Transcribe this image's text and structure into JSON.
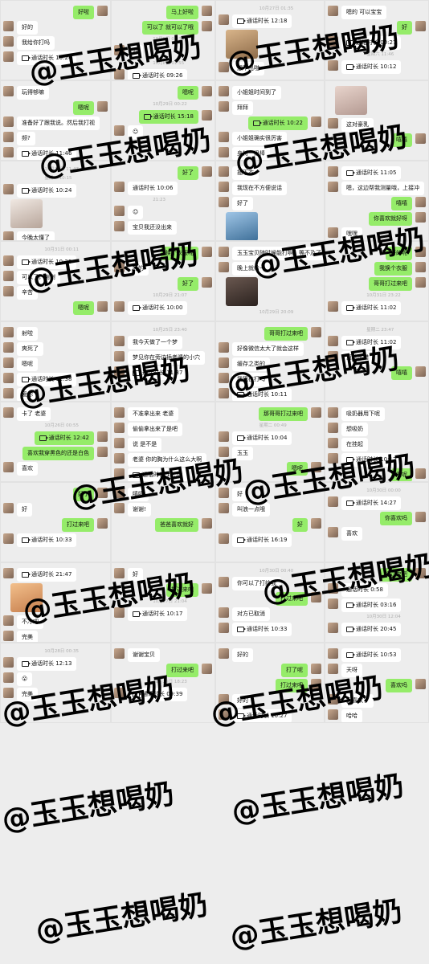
{
  "watermark_text": "@玉玉想喝奶",
  "panels": [
    {
      "messages": [
        {
          "type": "out",
          "text": "好啦"
        },
        {
          "type": "in",
          "text": "好的"
        },
        {
          "type": "in",
          "text": "我给你打吗"
        },
        {
          "type": "in",
          "call": true,
          "text": "通话时长 10:24"
        }
      ]
    },
    {
      "messages": [
        {
          "type": "out",
          "text": "马上好啦"
        },
        {
          "type": "out",
          "text": "可以了 就可以了哦"
        },
        {
          "type": "ts",
          "text": "10月8日 01:34"
        },
        {
          "type": "in",
          "text": "好"
        },
        {
          "type": "ts",
          "text": "10月8日 01:55"
        },
        {
          "type": "in",
          "call": true,
          "text": "通话时长 09:26"
        },
        {
          "type": "in",
          "text": "早点休息哈！"
        }
      ]
    },
    {
      "messages": [
        {
          "type": "ts",
          "text": "10月27日 01:35"
        },
        {
          "type": "in",
          "call": true,
          "text": "通话时长 12:18"
        },
        {
          "type": "photo",
          "name": "dog-photo"
        },
        {
          "type": "in",
          "text": "想不出啦"
        }
      ]
    },
    {
      "messages": [
        {
          "type": "in",
          "text": "嗯的 可以宝宝"
        },
        {
          "type": "out",
          "text": "好"
        },
        {
          "type": "in",
          "call": true,
          "text": "通话时长 00:27"
        },
        {
          "type": "ts",
          "text": "星期六 11:46"
        },
        {
          "type": "in",
          "call": true,
          "text": "通话时长 10:12"
        },
        {
          "type": "in",
          "call": true,
          "text": "通话时长 08:24"
        }
      ]
    },
    {
      "messages": [
        {
          "type": "in",
          "text": "玩得够嘛"
        },
        {
          "type": "out",
          "text": "嗯呢"
        },
        {
          "type": "in",
          "text": "准备好了跟我说。然后我打视"
        },
        {
          "type": "in",
          "text": "频?"
        },
        {
          "type": "in",
          "call": true,
          "text": "通话时长 11:46"
        },
        {
          "type": "ts",
          "text": "10月31日 11:50"
        }
      ]
    },
    {
      "messages": [
        {
          "type": "out",
          "text": "嗯呢"
        },
        {
          "type": "ts",
          "text": "10月29日 00:22"
        },
        {
          "type": "out",
          "call": true,
          "text": "通话时长 15:18"
        },
        {
          "type": "in",
          "text": "☺"
        }
      ]
    },
    {
      "messages": [
        {
          "type": "in",
          "text": "小姐姐时间到了"
        },
        {
          "type": "in",
          "text": "拜拜"
        },
        {
          "type": "out",
          "call": true,
          "text": "通话时长 10:22"
        },
        {
          "type": "in",
          "text": "小姐姐确实很厉害"
        },
        {
          "type": "in",
          "text": "身材一级棒"
        },
        {
          "type": "out",
          "text": "嘻嘻"
        }
      ]
    },
    {
      "messages": [
        {
          "type": "photo",
          "name": "portrait-photo"
        },
        {
          "type": "in",
          "text": "这对豪乳"
        },
        {
          "type": "out",
          "text": "嘻嘻"
        }
      ]
    },
    {
      "messages": [
        {
          "type": "ts",
          "text": "10月31日 11:47"
        },
        {
          "type": "ts",
          "text": "星期一 10:15"
        },
        {
          "type": "in",
          "call": true,
          "text": "通话时长 10:24"
        },
        {
          "type": "photo",
          "name": "cat-sticker"
        },
        {
          "type": "in",
          "text": "今晚太懂了"
        }
      ]
    },
    {
      "messages": [
        {
          "type": "out",
          "text": "好了"
        },
        {
          "type": "in",
          "text": "通话时长 10:06"
        },
        {
          "type": "ts",
          "text": "21:23"
        },
        {
          "type": "in",
          "text": "☺"
        },
        {
          "type": "in",
          "text": "宝贝我还没出来"
        }
      ]
    },
    {
      "messages": [
        {
          "type": "in",
          "text": "插下衣"
        },
        {
          "type": "in",
          "text": "我现在不方便说话"
        },
        {
          "type": "in",
          "text": "好了"
        },
        {
          "type": "photo",
          "name": "thumb-sticker"
        },
        {
          "type": "in",
          "text": "朋克的青龙"
        },
        {
          "type": "out",
          "call": true,
          "text": "通话时长 09:57"
        }
      ]
    },
    {
      "messages": [
        {
          "type": "in",
          "call": true,
          "text": "通话时长 11:05"
        },
        {
          "type": "in",
          "text": "嗯，这边帮我测量哦，上接冲"
        },
        {
          "type": "out",
          "text": "嘻嘻"
        },
        {
          "type": "out",
          "text": "你喜欢就好呀"
        },
        {
          "type": "in",
          "text": "嘿嘿"
        }
      ]
    },
    {
      "messages": [
        {
          "type": "ts",
          "text": "10月31日 00:11"
        },
        {
          "type": "in",
          "call": true,
          "text": "通话时长 10:25"
        },
        {
          "type": "in",
          "text": "可以了，谢谢"
        },
        {
          "type": "in",
          "text": "辛苦"
        },
        {
          "type": "out",
          "text": "嗯呢"
        }
      ]
    },
    {
      "messages": [
        {
          "type": "out",
          "text": "换个衣服呢"
        },
        {
          "type": "in",
          "text": "好的"
        },
        {
          "type": "out",
          "text": "好了"
        },
        {
          "type": "ts",
          "text": "10月29日 21:07"
        },
        {
          "type": "in",
          "call": true,
          "text": "通话时长 10:00"
        },
        {
          "type": "in",
          "text": "辛苦"
        }
      ]
    },
    {
      "messages": [
        {
          "type": "in",
          "text": "玉玉宝贝随时候能打啊，等不及了"
        },
        {
          "type": "in",
          "text": "晚上就给~"
        },
        {
          "type": "photo",
          "name": "shadow-photo"
        },
        {
          "type": "ts",
          "text": "10月29日 20:09"
        },
        {
          "type": "in",
          "text": "好大的奶😍😍😍"
        },
        {
          "type": "out",
          "text": "手机最近消息提示总是延迟"
        }
      ]
    },
    {
      "messages": [
        {
          "type": "out",
          "text": "好的呢"
        },
        {
          "type": "out",
          "text": "我换个衣服"
        },
        {
          "type": "out",
          "text": "哥哥打过来吧"
        },
        {
          "type": "ts",
          "text": "10月31日 23:22"
        },
        {
          "type": "in",
          "call": true,
          "text": "通话时长 11:02"
        }
      ]
    },
    {
      "messages": [
        {
          "type": "in",
          "text": "射啦"
        },
        {
          "type": "in",
          "text": "爽死了"
        },
        {
          "type": "in",
          "text": "嗯呢"
        },
        {
          "type": "in",
          "call": true,
          "text": "通话时长 11:38"
        },
        {
          "type": "in",
          "text": "爱你"
        },
        {
          "type": "out",
          "text": "嘻嘻"
        }
      ]
    },
    {
      "messages": [
        {
          "type": "ts",
          "text": "10月25日 23:40"
        },
        {
          "type": "in",
          "text": "我今天做了一个梦"
        },
        {
          "type": "in",
          "text": "梦见你在旁边插老婆的小穴"
        },
        {
          "type": "in",
          "call": true,
          "text": "通话时长 11:37"
        }
      ]
    },
    {
      "messages": [
        {
          "type": "out",
          "text": "哥哥打过来吧"
        },
        {
          "type": "in",
          "text": "好像微信太大了就会这样"
        },
        {
          "type": "in",
          "text": "缓存之类的"
        },
        {
          "type": "in",
          "text": "我现在打吗"
        },
        {
          "type": "in",
          "call": true,
          "text": "通话时长 10:11"
        }
      ]
    },
    {
      "messages": [
        {
          "type": "ts",
          "text": "星期二 23:47"
        },
        {
          "type": "in",
          "call": true,
          "text": "通话时长 11:02"
        },
        {
          "type": "in",
          "text": "真的不错"
        },
        {
          "type": "out",
          "text": "嘻嘻"
        }
      ]
    },
    {
      "messages": [
        {
          "type": "in",
          "text": "卡了 老婆"
        },
        {
          "type": "ts",
          "text": "10月26日 00:55"
        },
        {
          "type": "out",
          "call": true,
          "text": "通话时长 12:42"
        },
        {
          "type": "out",
          "text": "喜欢我穿黑色的还是白色"
        },
        {
          "type": "in",
          "text": "喜欢"
        }
      ]
    },
    {
      "messages": [
        {
          "type": "in",
          "text": "不准拿出来 老婆"
        },
        {
          "type": "in",
          "text": "偷偷拿出来了是吧"
        },
        {
          "type": "in",
          "text": "说 是不是"
        },
        {
          "type": "in",
          "text": "老婆 你的胸为什么这么大啊"
        },
        {
          "type": "in",
          "call": true,
          "text": "通话时长 12:52"
        }
      ]
    },
    {
      "messages": [
        {
          "type": "out",
          "text": "那哥哥打过来吧"
        },
        {
          "type": "ts",
          "text": "星期二 00:49"
        },
        {
          "type": "in",
          "call": true,
          "text": "通话时长 10:04"
        },
        {
          "type": "in",
          "text": "玉玉"
        },
        {
          "type": "out",
          "text": "嗯呢"
        }
      ]
    },
    {
      "messages": [
        {
          "type": "in",
          "text": "吸奶器用下呢"
        },
        {
          "type": "in",
          "text": "想吸奶"
        },
        {
          "type": "in",
          "text": "在挂起"
        },
        {
          "type": "in",
          "call": true,
          "text": "通话时长 10:12"
        },
        {
          "type": "out",
          "text": "嗯呢"
        }
      ]
    },
    {
      "messages": [
        {
          "type": "out",
          "text": "好了"
        },
        {
          "type": "in",
          "text": "好"
        },
        {
          "type": "out",
          "text": "打过来吧"
        },
        {
          "type": "in",
          "call": true,
          "text": "通话时长 10:33"
        }
      ]
    },
    {
      "messages": [
        {
          "type": "in",
          "text": "嘻嘻"
        },
        {
          "type": "in",
          "text": "谢谢!"
        },
        {
          "type": "out",
          "text": "爸爸喜欢就好"
        }
      ]
    },
    {
      "messages": [
        {
          "type": "in",
          "text": "好"
        },
        {
          "type": "in",
          "text": "叫浪一点哦"
        },
        {
          "type": "out",
          "text": "好"
        },
        {
          "type": "in",
          "call": true,
          "text": "通话时长 16:19"
        }
      ]
    },
    {
      "messages": [
        {
          "type": "ts",
          "text": "10月30日 00:00"
        },
        {
          "type": "in",
          "call": true,
          "text": "通话时长 14:27"
        },
        {
          "type": "out",
          "text": "你喜欢吗"
        },
        {
          "type": "in",
          "text": "喜欢"
        }
      ]
    },
    {
      "messages": [
        {
          "type": "in",
          "call": true,
          "text": "通话时长 21:47"
        },
        {
          "type": "photo",
          "name": "baby-sticker"
        },
        {
          "type": "in",
          "text": "不冷吧"
        },
        {
          "type": "in",
          "text": "完美"
        },
        {
          "type": "in",
          "text": "更想玩你的了"
        }
      ]
    },
    {
      "messages": [
        {
          "type": "in",
          "text": "好"
        },
        {
          "type": "out",
          "text": "打过来吧"
        },
        {
          "type": "ts",
          "text": "10月27日 21:04"
        },
        {
          "type": "in",
          "call": true,
          "text": "通话时长 10:17"
        }
      ]
    },
    {
      "messages": [
        {
          "type": "ts",
          "text": "10月30日 00:40"
        },
        {
          "type": "in",
          "text": "你可以了打给我"
        },
        {
          "type": "out",
          "text": "打过来吧"
        },
        {
          "type": "in",
          "text": "对方已取消"
        },
        {
          "type": "in",
          "call": true,
          "text": "通话时长 10:33"
        }
      ]
    },
    {
      "messages": [
        {
          "type": "out",
          "text": "打过来吧"
        },
        {
          "type": "in",
          "text": "通话时长 0:58"
        },
        {
          "type": "in",
          "call": true,
          "text": "通话时长 03:16"
        },
        {
          "type": "ts",
          "text": "10月30日 12:04"
        },
        {
          "type": "in",
          "call": true,
          "text": "通话时长 20:45"
        }
      ]
    },
    {
      "messages": [
        {
          "type": "ts",
          "text": "10月28日 00:35"
        },
        {
          "type": "in",
          "call": true,
          "text": "通话时长 12:13"
        },
        {
          "type": "in",
          "text": "😮"
        },
        {
          "type": "in",
          "text": "完美"
        }
      ]
    },
    {
      "messages": [
        {
          "type": "in",
          "text": "谢谢宝贝"
        },
        {
          "type": "out",
          "text": "打过来吧"
        },
        {
          "type": "ts",
          "text": "10月29日 18:23"
        },
        {
          "type": "in",
          "call": true,
          "text": "通话时长 09:39"
        }
      ]
    },
    {
      "messages": [
        {
          "type": "in",
          "text": "好的"
        },
        {
          "type": "out",
          "text": "打了呢"
        },
        {
          "type": "out",
          "text": "打过来吧"
        },
        {
          "type": "in",
          "text": "好的"
        },
        {
          "type": "in",
          "call": true,
          "text": "通话时长 10:27"
        }
      ]
    },
    {
      "messages": [
        {
          "type": "in",
          "call": true,
          "text": "通话时长 10:53"
        },
        {
          "type": "in",
          "text": "天呀"
        },
        {
          "type": "out",
          "text": "喜欢吗"
        },
        {
          "type": "in",
          "text": "太喜欢了"
        },
        {
          "type": "in",
          "text": "哈哈"
        }
      ]
    }
  ]
}
